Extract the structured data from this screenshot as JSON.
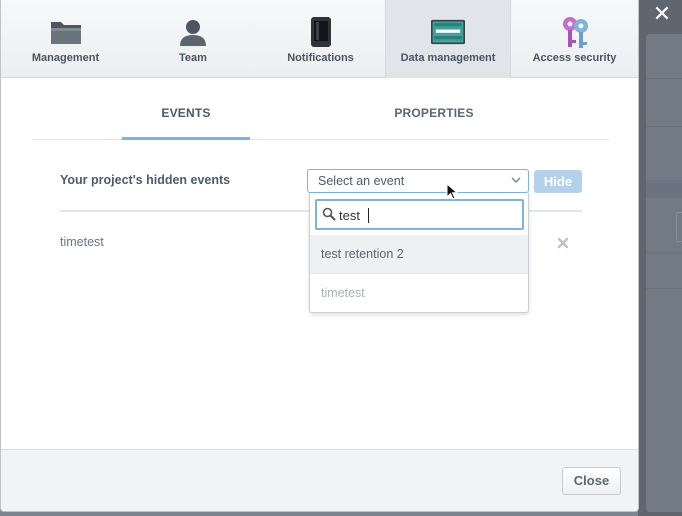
{
  "nav": {
    "tabs": [
      {
        "label": "Management",
        "icon": "folder-icon"
      },
      {
        "label": "Team",
        "icon": "person-icon"
      },
      {
        "label": "Notifications",
        "icon": "phone-icon"
      },
      {
        "label": "Data management",
        "icon": "keyboard-icon"
      },
      {
        "label": "Access security",
        "icon": "keys-icon"
      }
    ],
    "active_index": 3
  },
  "subtabs": {
    "events_label": "EVENTS",
    "properties_label": "PROPERTIES"
  },
  "hidden_events": {
    "label": "Your project's hidden events",
    "select_placeholder": "Select an event",
    "hide_button": "Hide",
    "items": [
      "timetest"
    ]
  },
  "dropdown": {
    "search_value": "test",
    "options": [
      {
        "label": "test retention 2",
        "state": "highlighted"
      },
      {
        "label": "timetest",
        "state": "disabled"
      }
    ]
  },
  "footer": {
    "close_button": "Close"
  },
  "colors": {
    "accent": "#7fb3d9",
    "hide_button_bg": "#b3d1eb",
    "text": "#4d5b6b"
  }
}
